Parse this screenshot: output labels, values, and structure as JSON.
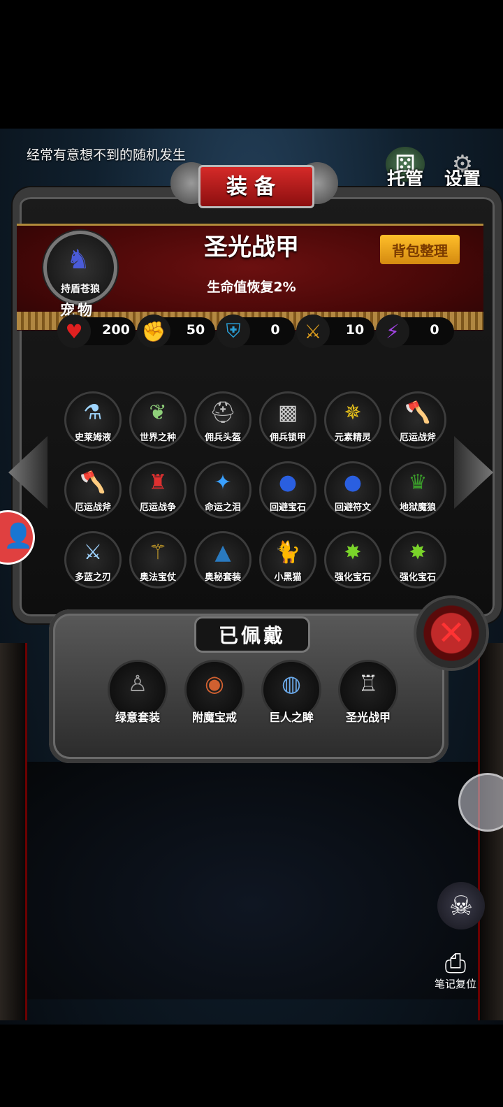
{
  "hud": {
    "tip_text": "经常有意想不到的随机发生",
    "auto_label": "托管",
    "settings_label": "设置"
  },
  "panel": {
    "title": "装备",
    "selected_item_name": "圣光战甲",
    "selected_item_desc": "生命值恢复2%",
    "sort_button": "背包整理",
    "pet_name": "持盾苍狼",
    "pet_label": "宠物"
  },
  "stats": [
    {
      "icon": "heart-icon",
      "value": "200"
    },
    {
      "icon": "strength-icon",
      "value": "50"
    },
    {
      "icon": "armor-icon",
      "value": "0"
    },
    {
      "icon": "sword-icon",
      "value": "10"
    },
    {
      "icon": "lightning-icon",
      "value": "0"
    }
  ],
  "inventory": [
    {
      "name": "史莱姆液",
      "icon": "potion-icon"
    },
    {
      "name": "世界之种",
      "icon": "seed-icon"
    },
    {
      "name": "佣兵头盔",
      "icon": "helmet-icon"
    },
    {
      "name": "佣兵锁甲",
      "icon": "chainmail-icon"
    },
    {
      "name": "元素精灵",
      "icon": "elemental-icon"
    },
    {
      "name": "厄运战斧",
      "icon": "axe-icon"
    },
    {
      "name": "厄运战斧",
      "icon": "axe-icon"
    },
    {
      "name": "厄运战争",
      "icon": "war-armor-icon"
    },
    {
      "name": "命运之泪",
      "icon": "tear-amulet-icon"
    },
    {
      "name": "回避宝石",
      "icon": "blue-gem-icon"
    },
    {
      "name": "回避符文",
      "icon": "blue-rune-icon"
    },
    {
      "name": "地狱魔狼",
      "icon": "demon-wolf-icon"
    },
    {
      "name": "多蓝之刃",
      "icon": "blade-icon"
    },
    {
      "name": "奥法宝仗",
      "icon": "staff-icon"
    },
    {
      "name": "奥秘套装",
      "icon": "robe-icon"
    },
    {
      "name": "小黑猫",
      "icon": "cat-icon"
    },
    {
      "name": "强化宝石",
      "icon": "green-gem-icon"
    },
    {
      "name": "强化宝石",
      "icon": "green-gem-icon"
    }
  ],
  "equipped": {
    "title": "已佩戴",
    "items": [
      {
        "name": "绿意套装",
        "icon": "green-armor-icon"
      },
      {
        "name": "附魔宝戒",
        "icon": "ring-icon"
      },
      {
        "name": "巨人之眸",
        "icon": "eye-icon"
      },
      {
        "name": "圣光战甲",
        "icon": "plate-armor-icon"
      }
    ]
  },
  "side": {
    "note_reset_label": "笔记复位"
  }
}
